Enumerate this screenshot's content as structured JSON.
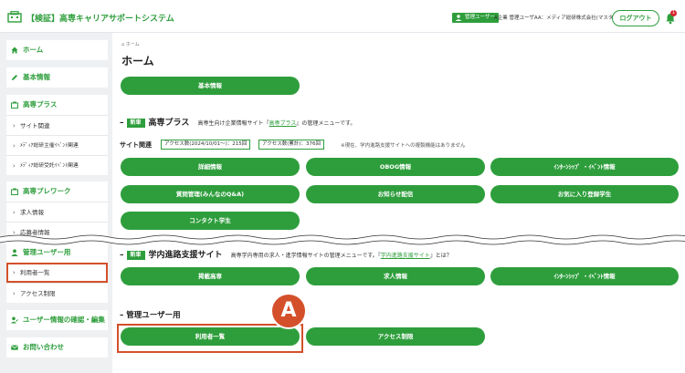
{
  "header": {
    "title": "【検証】高専キャリアサポートシステム",
    "admin_badge": "管理ユーザー",
    "user_name": "A企業 管理ユーザAA：メディア総研株式会社(マスタ)",
    "logout": "ログアウト",
    "notification_count": "1"
  },
  "sidebar": {
    "home": "ホーム",
    "basic_info": "基本情報",
    "kosen_plus": "高専プラス",
    "kosen_plus_items": [
      "サイト関連",
      "ﾒﾃﾞｨｱ総研主催ｲﾍﾞﾝﾄ関連",
      "ﾒﾃﾞｨｱ総研受託ｲﾍﾞﾝﾄ関連"
    ],
    "kosen_work": "高専プレワーク",
    "kosen_work_items": [
      "求人情報",
      "応募者情報"
    ],
    "admin": "管理ユーザー用",
    "admin_items": [
      "利用者一覧",
      "アクセス制限"
    ],
    "user_confirm": "ユーザー情報の確認・編集",
    "contact": "お問い合わせ"
  },
  "main": {
    "breadcrumb": "ホーム",
    "title": "ホーム",
    "basic_info_btn": "基本情報",
    "kosen_plus": {
      "badge": "新車",
      "title": "高専プラス",
      "note_pre": "高専生向け企業情報サイト『",
      "note_link": "高専プラス",
      "note_post": "』の管理メニューです。",
      "site_label": "サイト関連",
      "access1": "アクセス数(2024/10/01～)：215回",
      "access2": "アクセス数(累計)：376回",
      "access_note": "※現在、学内進路支援サイトへの複製機能はありません",
      "buttons": [
        "詳細情報",
        "OBOG情報",
        "ｲﾝﾀｰﾝｼｯﾌﾟ ・ｲﾍﾞﾝﾄ情報",
        "質問管理(みんなのQ&A)",
        "お知らせ配信",
        "お気に入り登録学生",
        "コンタクト学生"
      ]
    },
    "campus": {
      "badge": "新車",
      "title": "学内進路支援サイト",
      "note_pre": "高専学内専用の求人・進学情報サイトの管理メニューです。『",
      "note_link": "学内進路支援サイト",
      "note_post": "』とは？",
      "buttons": [
        "掲載高専",
        "求人情報",
        "ｲﾝﾀｰﾝｼｯﾌﾟ ・ｲﾍﾞﾝﾄ情報"
      ]
    },
    "admin": {
      "title": "管理ユーザー用",
      "buttons": [
        "利用者一覧",
        "アクセス制限"
      ]
    },
    "marker": "A"
  }
}
